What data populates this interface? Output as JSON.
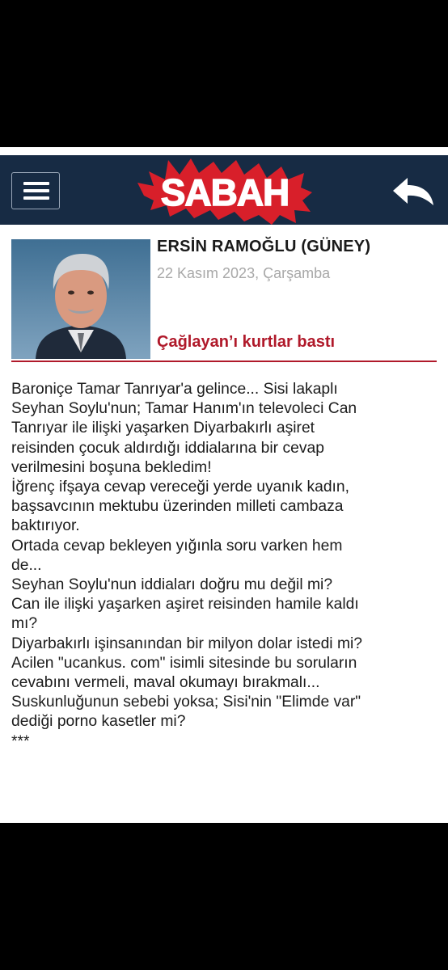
{
  "header": {
    "logo_text": "SABAH",
    "menu_icon": "hamburger-menu-icon",
    "back_icon": "back-arrow-icon",
    "background_color": "#172b44",
    "logo_color": "#d81f2a"
  },
  "author": {
    "name": "ERSİN RAMOĞLU (GÜNEY)",
    "date": "22 Kasım 2023, Çarşamba",
    "photo": "author-portrait"
  },
  "article": {
    "title": "Çağlayan’ı kurtlar bastı",
    "title_color": "#b0192a",
    "lines": [
      "Baroniçe Tamar Tanrıyar'a gelince... Sisi lakaplı",
      "Seyhan Soylu'nun; Tamar Hanım'ın televoleci Can",
      "Tanrıyar ile ilişki yaşarken Diyarbakırlı aşiret",
      "reisinden çocuk aldırdığı iddialarına bir cevap",
      "verilmesini boşuna bekledim!",
      "İğrenç ifşaya cevap vereceği yerde uyanık kadın,",
      "başsavcının mektubu üzerinden milleti cambaza",
      "baktırıyor.",
      "Ortada cevap bekleyen yığınla soru varken hem",
      "de...",
      "Seyhan Soylu'nun iddiaları doğru mu değil mi?",
      "Can ile ilişki yaşarken aşiret reisinden hamile kaldı",
      "mı?",
      "Diyarbakırlı işinsanından bir milyon dolar istedi mi?",
      "Acilen \"ucankus. com\" isimli sitesinde bu soruların",
      "cevabını vermeli, maval okumayı bırakmalı...",
      "Suskunluğunun sebebi yoksa; Sisi'nin \"Elimde var\"",
      "dediği porno kasetler mi?",
      "***"
    ]
  }
}
